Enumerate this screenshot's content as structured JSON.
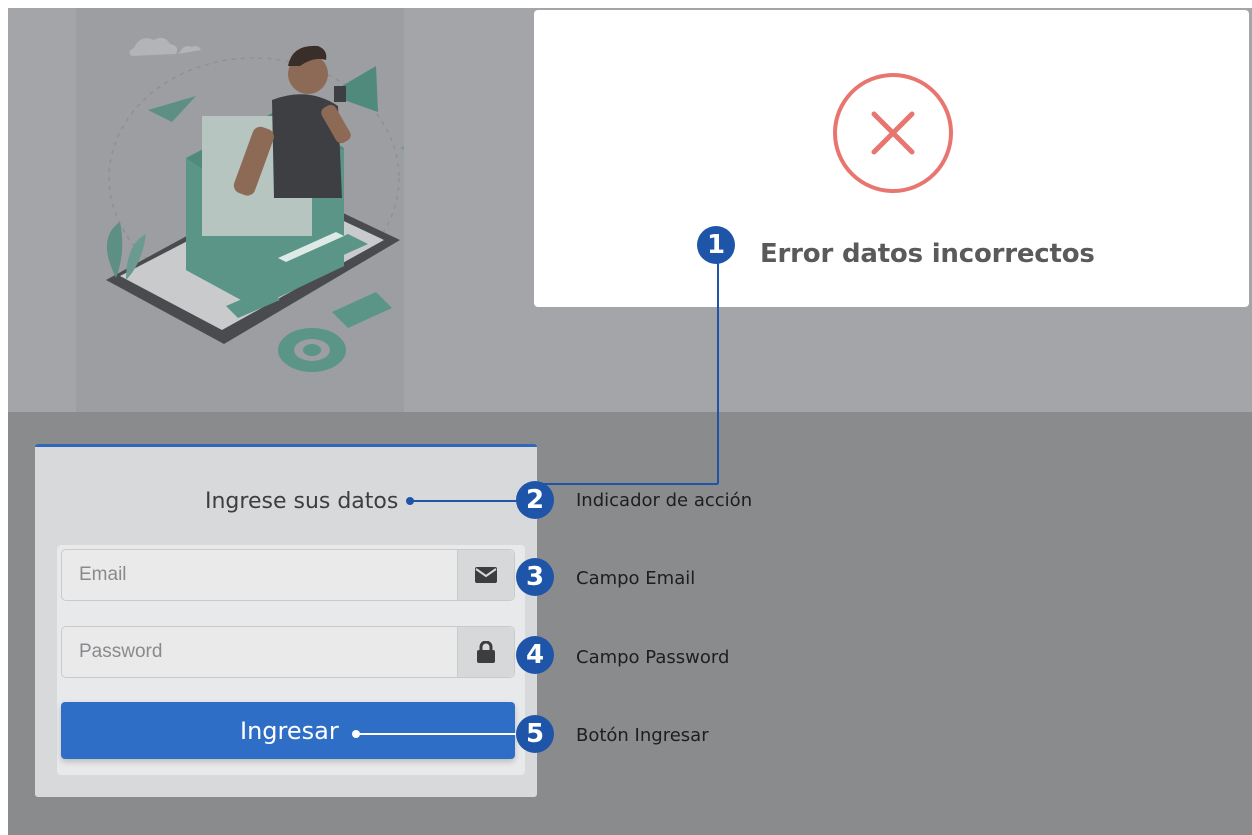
{
  "error_modal": {
    "message": "Error datos incorrectos",
    "icon": "x-circle-icon",
    "icon_color": "#e8756f"
  },
  "login": {
    "title": "Ingrese sus datos",
    "email_placeholder": "Email",
    "email_icon": "envelope-icon",
    "password_placeholder": "Password",
    "password_icon": "lock-icon",
    "submit_label": "Ingresar",
    "accent_color": "#2f6ec6"
  },
  "callouts": [
    {
      "number": "1",
      "label": ""
    },
    {
      "number": "2",
      "label": "Indicador de acción"
    },
    {
      "number": "3",
      "label": "Campo Email"
    },
    {
      "number": "4",
      "label": "Campo Password"
    },
    {
      "number": "5",
      "label": "Botón Ingresar"
    }
  ]
}
